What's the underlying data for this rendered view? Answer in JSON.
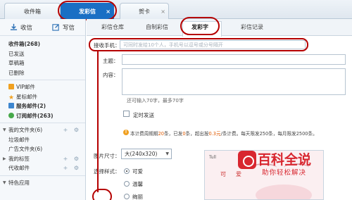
{
  "top_tabs": {
    "inbox": "收件箱",
    "mms": "发彩信",
    "card": "贺卡",
    "close_glyph": "×"
  },
  "sidebar": {
    "receive": "收信",
    "write": "写信",
    "folders": [
      {
        "label": "收件箱(268)",
        "bold": true
      },
      {
        "label": "已发送",
        "bold": false
      },
      {
        "label": "草稿箱",
        "bold": false
      },
      {
        "label": "已删除",
        "bold": false
      }
    ],
    "special": [
      {
        "label": "VIP邮件",
        "icon": "vip-icon"
      },
      {
        "label": "星标邮件",
        "icon": "star-icon"
      },
      {
        "label": "服务邮件(2)",
        "icon": "service-icon"
      },
      {
        "label": "订阅邮件(263)",
        "icon": "subscribe-icon"
      }
    ],
    "my_folders": "我的文件夹(6)",
    "junk": "垃圾邮件",
    "ads": "广告文件夹(6)",
    "my_tags": "我的标签",
    "agent": "代收邮件",
    "apps": "特色应用",
    "tool_glyphs": "+ ⚙"
  },
  "sub_tabs": [
    "彩信仓库",
    "自制彩信",
    "发彩字",
    "彩信记录"
  ],
  "form": {
    "recipient_label": "接收手机：",
    "recipient_placeholder": "可同时发给10个人，手机号以逗号或分号隔开",
    "subject_label": "主题：",
    "content_label": "内容：",
    "counter_prefix": "还可输入",
    "counter_value": "70",
    "counter_mid": "字，最多",
    "counter_max": "70",
    "counter_suffix": "字",
    "timed_send": "定时发送",
    "notice_1": "本计费周期期",
    "notice_sent_count": "20",
    "notice_2": "条，已发",
    "notice_sent": "0",
    "notice_3": "条，超出按",
    "notice_price": "0.3元",
    "notice_4": "/条计费。每天限发250条，每月限发2500条。",
    "size_label": "图片尺寸：",
    "size_value": "大(240x320)",
    "style_label": "选择样式：",
    "styles": [
      {
        "label": "可爱",
        "selected": true
      },
      {
        "label": "温馨",
        "selected": false
      },
      {
        "label": "绚丽",
        "selected": false
      }
    ]
  },
  "preview": {
    "signal": "Tull",
    "text": "可爱"
  },
  "watermark": {
    "main": "百科全说",
    "sub": "助你轻松解决"
  },
  "colors": {
    "accent": "#1a6fc4",
    "annotation": "#b50000",
    "highlight": "#e05a00",
    "watermark": "#d8262f"
  }
}
